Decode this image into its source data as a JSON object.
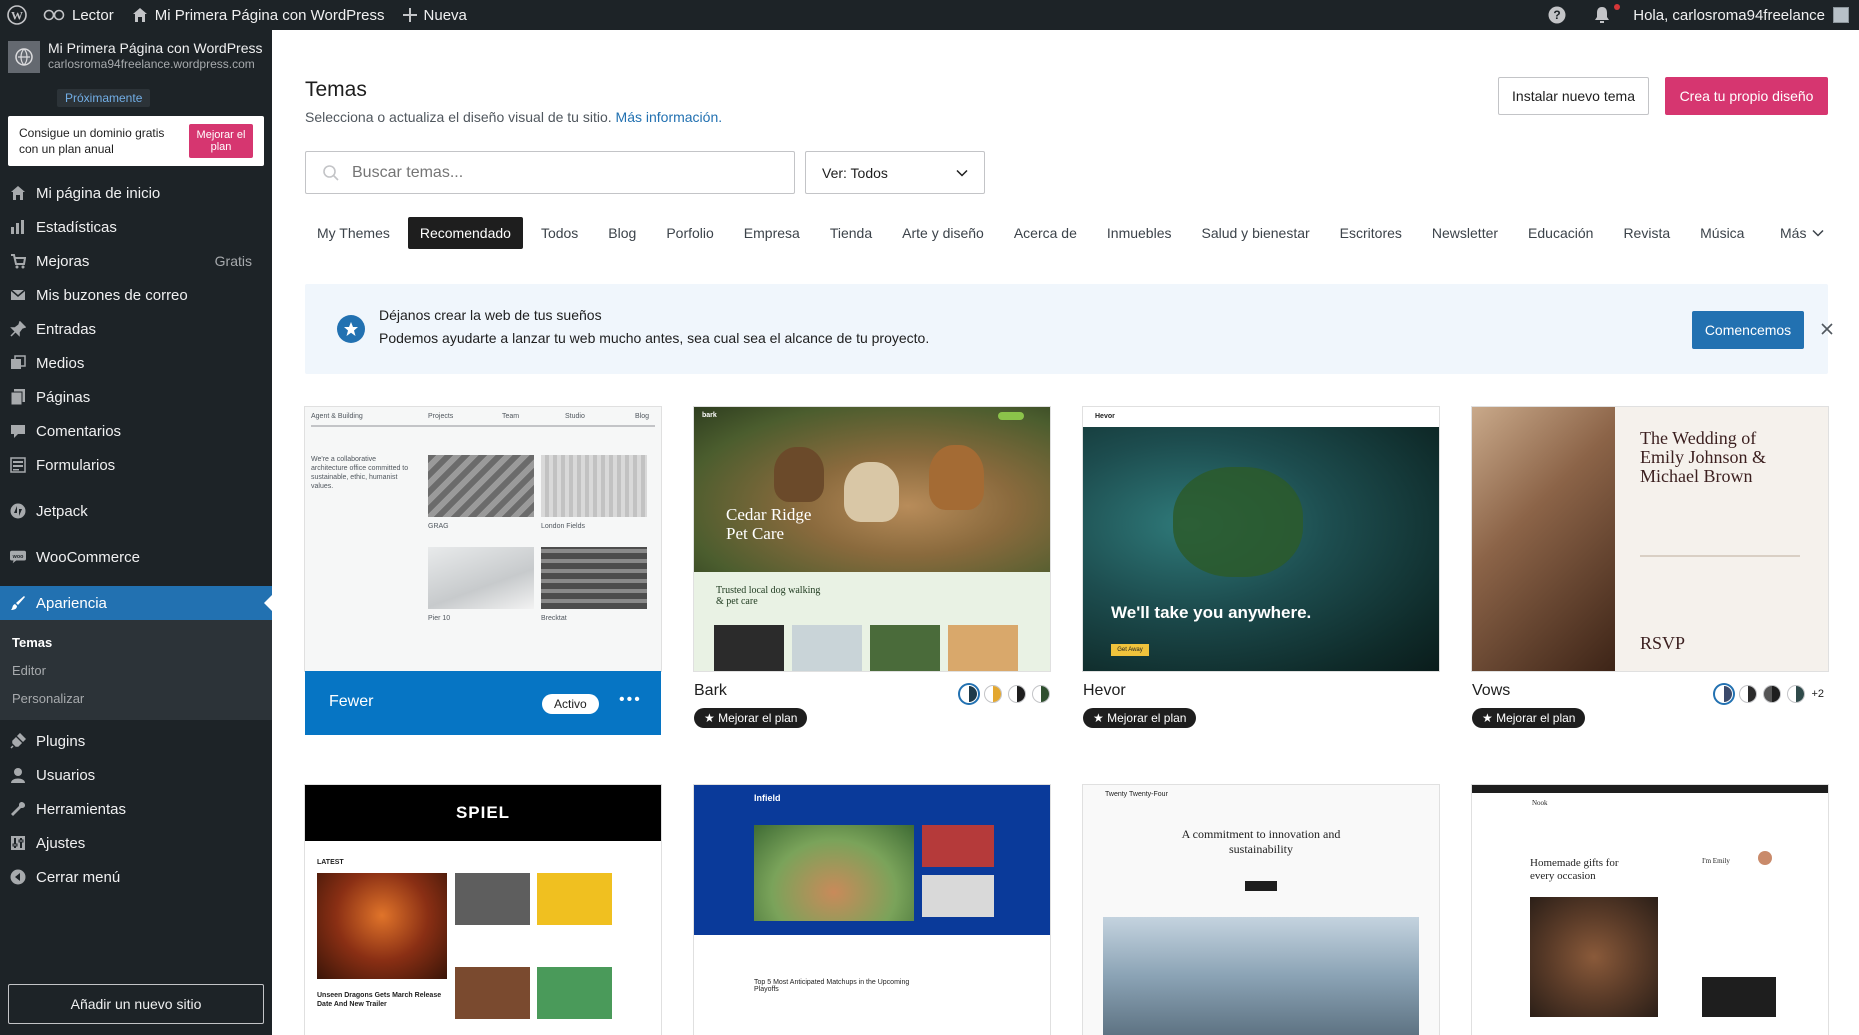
{
  "adminbar": {
    "reader": "Lector",
    "site": "Mi Primera Página con WordPress",
    "new": "Nueva",
    "greeting": "Hola, carlosroma94freelance"
  },
  "sidebar": {
    "site_name": "Mi Primera Página con WordPress",
    "site_url": "carlosroma94freelance.wordpress.com",
    "site_status": "Próximamente",
    "promo_text": "Consigue un dominio gratis con un plan anual",
    "promo_button": "Mejorar el plan",
    "items": [
      {
        "label": "Mi página de inicio",
        "icon": "home-icon"
      },
      {
        "label": "Estadísticas",
        "icon": "stats-icon"
      },
      {
        "label": "Mejoras",
        "icon": "cart-icon",
        "extra": "Gratis"
      },
      {
        "label": "Mis buzones de correo",
        "icon": "mail-icon"
      },
      {
        "label": "Entradas",
        "icon": "pin-icon"
      },
      {
        "label": "Medios",
        "icon": "media-icon"
      },
      {
        "label": "Páginas",
        "icon": "pages-icon"
      },
      {
        "label": "Comentarios",
        "icon": "comment-icon"
      },
      {
        "label": "Formularios",
        "icon": "forms-icon"
      },
      {
        "label": "Jetpack",
        "icon": "jetpack-icon"
      },
      {
        "label": "WooCommerce",
        "icon": "woo-icon"
      },
      {
        "label": "Apariencia",
        "icon": "brush-icon"
      },
      {
        "label": "Plugins",
        "icon": "plugin-icon"
      },
      {
        "label": "Usuarios",
        "icon": "user-icon"
      },
      {
        "label": "Herramientas",
        "icon": "wrench-icon"
      },
      {
        "label": "Ajustes",
        "icon": "settings-icon"
      },
      {
        "label": "Cerrar menú",
        "icon": "collapse-icon"
      }
    ],
    "submenu": [
      "Temas",
      "Editor",
      "Personalizar"
    ],
    "add_site": "Añadir un nuevo sitio"
  },
  "main": {
    "title": "Temas",
    "subtitle": "Selecciona o actualiza el diseño visual de tu sitio.",
    "subtitle_link": "Más información.",
    "install_button": "Instalar nuevo tema",
    "design_button": "Crea tu propio diseño",
    "search_placeholder": "Buscar temas...",
    "filter_value": "Ver: Todos",
    "tabs": [
      "My Themes",
      "Recomendado",
      "Todos",
      "Blog",
      "Porfolio",
      "Empresa",
      "Tienda",
      "Arte y diseño",
      "Acerca de",
      "Inmuebles",
      "Salud y bienestar",
      "Escritores",
      "Newsletter",
      "Educación",
      "Revista",
      "Música"
    ],
    "tab_more": "Más",
    "banner": {
      "title": "Déjanos crear la web de tus sueños",
      "text": "Podemos ayudarte a lanzar tu web mucho antes, sea cual sea el alcance de tu proyecto.",
      "button": "Comencemos"
    },
    "themes": [
      {
        "name": "Fewer",
        "status": "Activo"
      },
      {
        "name": "Bark",
        "pill": "★ Mejorar el plan"
      },
      {
        "name": "Hevor",
        "pill": "★ Mejorar el plan"
      },
      {
        "name": "Vows",
        "pill": "★ Mejorar el plan",
        "more": "+2"
      }
    ],
    "thumbs": {
      "fewer": {
        "nav": [
          "Agent & Building",
          "Projects",
          "Team",
          "Studio",
          "Blog"
        ],
        "intro": "We're a collaborative architecture office committed to sustainable, ethic, humanist values.",
        "captions": [
          "GRAG",
          "London Fields",
          "Pier 10",
          "Brecktat"
        ]
      },
      "bark": {
        "brand": "bark",
        "title1": "Cedar Ridge",
        "title2": "Pet Care",
        "tagline": "Trusted local dog walking & pet care"
      },
      "hevor": {
        "brand": "Hevor",
        "headline": "We'll take you anywhere.",
        "cta": "Get Away"
      },
      "vows": {
        "title": "The Wedding of Emily Johnson & Michael Brown",
        "rsvp": "RSVP"
      },
      "spiel": {
        "logo": "SPIEL",
        "section": "LATEST",
        "headline": "Unseen Dragons Gets March Release Date And New Trailer"
      },
      "infield": {
        "logo": "Infield",
        "headline": "Top 5 Most Anticipated Matchups in the Upcoming Playoffs"
      },
      "tt4": {
        "brand": "Twenty Twenty-Four",
        "headline": "A commitment to innovation and sustainability"
      },
      "nook": {
        "brand": "Nook",
        "headline": "Homemade gifts for every occasion",
        "greeting": "I'm Emily"
      }
    }
  },
  "colors": {
    "accent": "#2271b1",
    "brand_pink": "#d63670",
    "admin_dark": "#1d2327",
    "active_card": "#0675c4"
  }
}
